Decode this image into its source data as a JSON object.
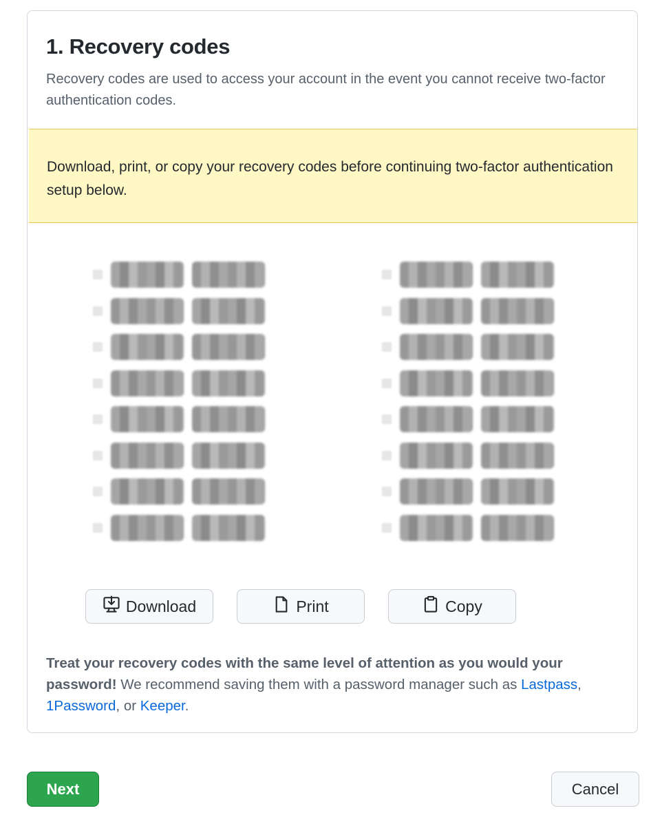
{
  "section": {
    "title": "1. Recovery codes",
    "description": "Recovery codes are used to access your account in the event you cannot receive two-factor authentication codes."
  },
  "warning": {
    "text": "Download, print, or copy your recovery codes before continuing two-factor authentication setup below."
  },
  "codes": {
    "obscured": true,
    "left_column_count": 8,
    "right_column_count": 8
  },
  "actions": {
    "download_label": "Download",
    "print_label": "Print",
    "copy_label": "Copy",
    "download_icon": "download-icon",
    "print_icon": "file-icon",
    "copy_icon": "clipboard-icon"
  },
  "note": {
    "bold": "Treat your recovery codes with the same level of attention as you would your password!",
    "text": " We recommend saving them with a password manager such as ",
    "link_lastpass": "Lastpass",
    "sep1": ", ",
    "link_1password": "1Password",
    "sep2": ", or ",
    "link_keeper": "Keeper",
    "end": "."
  },
  "footer": {
    "next_label": "Next",
    "cancel_label": "Cancel"
  },
  "colors": {
    "primary": "#2da44e",
    "link": "#0969da",
    "warning_bg": "#fff8c5",
    "border": "#d0d7de"
  }
}
